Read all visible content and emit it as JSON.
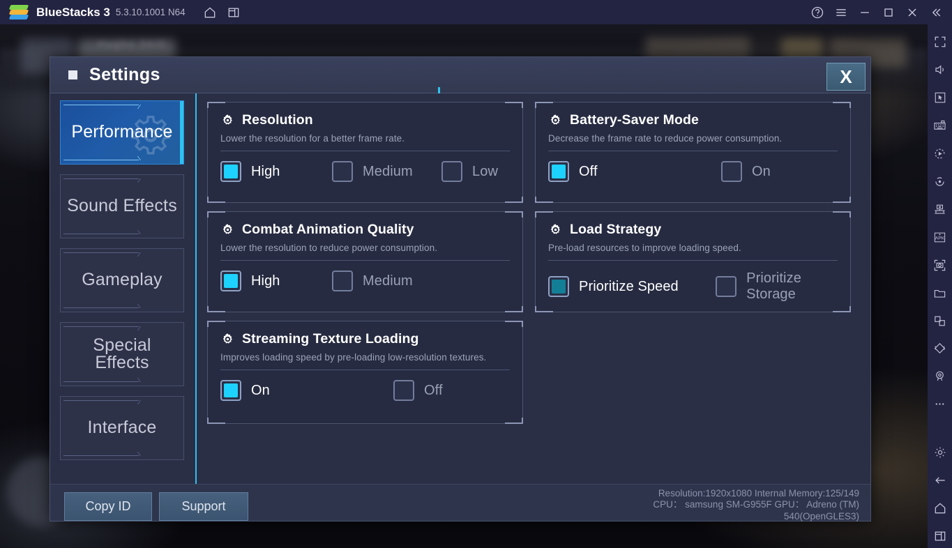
{
  "titlebar": {
    "app_name": "BlueStacks 3",
    "version": "5.3.10.1001 N64",
    "left_icons": [
      {
        "name": "home-icon",
        "label": "Home"
      },
      {
        "name": "multi-instance-icon",
        "label": "Multi-instance"
      }
    ],
    "right_icons": [
      {
        "name": "help-icon",
        "label": "Help"
      },
      {
        "name": "menu-icon",
        "label": "Menu"
      },
      {
        "name": "minimize-icon",
        "label": "Minimize"
      },
      {
        "name": "maximize-icon",
        "label": "Maximize"
      },
      {
        "name": "close-icon",
        "label": "Close"
      },
      {
        "name": "collapse-sidebar-icon",
        "label": "Collapse"
      }
    ]
  },
  "right_toolbar": {
    "icons": [
      {
        "name": "fullscreen-icon",
        "label": "Fullscreen"
      },
      {
        "name": "volume-icon",
        "label": "Volume"
      },
      {
        "name": "cursor-control-icon",
        "label": "Cursor control"
      },
      {
        "name": "keymapping-icon",
        "label": "Game controls"
      },
      {
        "name": "macro-recorder-icon",
        "label": "Macro recorder"
      },
      {
        "name": "rotate-icon",
        "label": "Rotate"
      },
      {
        "name": "multi-instance-manager-icon",
        "label": "Instance manager"
      },
      {
        "name": "install-apk-icon",
        "label": "Install APK"
      },
      {
        "name": "screenshot-icon",
        "label": "Screenshot"
      },
      {
        "name": "media-manager-icon",
        "label": "Media manager"
      },
      {
        "name": "copy-paste-icon",
        "label": "Copy to clipboard"
      },
      {
        "name": "shake-icon",
        "label": "Shake"
      },
      {
        "name": "location-icon",
        "label": "Location"
      },
      {
        "name": "more-icon",
        "label": "More"
      },
      {
        "name": "settings-icon",
        "label": "Settings"
      },
      {
        "name": "back-icon",
        "label": "Back"
      },
      {
        "name": "home-icon",
        "label": "Home"
      },
      {
        "name": "recents-icon",
        "label": "Recent apps"
      }
    ]
  },
  "dialog": {
    "title": "Settings",
    "close_label": "X",
    "sidebar": {
      "items": [
        {
          "label": "Performance",
          "active": true
        },
        {
          "label": "Sound Effects",
          "active": false
        },
        {
          "label": "Gameplay",
          "active": false
        },
        {
          "label": "Special\nEffects",
          "active": false
        },
        {
          "label": "Interface",
          "active": false
        }
      ]
    },
    "panels": [
      {
        "title": "Resolution",
        "desc": "Lower the resolution for a better frame rate.",
        "options": [
          {
            "label": "High",
            "selected": true,
            "dim": false
          },
          {
            "label": "Medium",
            "selected": false,
            "dim": false
          },
          {
            "label": "Low",
            "selected": false,
            "dim": false
          }
        ]
      },
      {
        "title": "Battery-Saver Mode",
        "desc": "Decrease the frame rate to reduce power consumption.",
        "options": [
          {
            "label": "Off",
            "selected": true,
            "dim": false
          },
          {
            "label": "On",
            "selected": false,
            "dim": false
          }
        ]
      },
      {
        "title": "Combat Animation Quality",
        "desc": "Lower the resolution to reduce power consumption.",
        "options": [
          {
            "label": "High",
            "selected": true,
            "dim": false
          },
          {
            "label": "Medium",
            "selected": false,
            "dim": false
          }
        ]
      },
      {
        "title": "Load Strategy",
        "desc": "Pre-load resources to improve loading speed.",
        "options": [
          {
            "label": "Prioritize Speed",
            "selected": true,
            "dim": true
          },
          {
            "label": "Prioritize Storage",
            "selected": false,
            "dim": false
          }
        ]
      },
      {
        "title": "Streaming Texture Loading",
        "desc": "Improves loading speed by pre-loading low-resolution textures.",
        "options": [
          {
            "label": "On",
            "selected": true,
            "dim": false
          },
          {
            "label": "Off",
            "selected": false,
            "dim": false
          }
        ]
      }
    ],
    "footer": {
      "copy_id_label": "Copy ID",
      "support_label": "Support",
      "sysinfo_line1": "Resolution:1920x1080  Internal Memory:125/149",
      "sysinfo_line2": "CPU： samsung SM-G955F  GPU： Adreno (TM)",
      "sysinfo_line3": "540(OpenGLES3)"
    }
  },
  "colors": {
    "accent_cyan": "#1ed2ff",
    "accent_cyan_dim": "#127f96",
    "titlebar_bg": "#232342",
    "dialog_bg": "#2a2f46",
    "panel_bg": "#262b41",
    "active_nav": "#1f5ba8"
  }
}
